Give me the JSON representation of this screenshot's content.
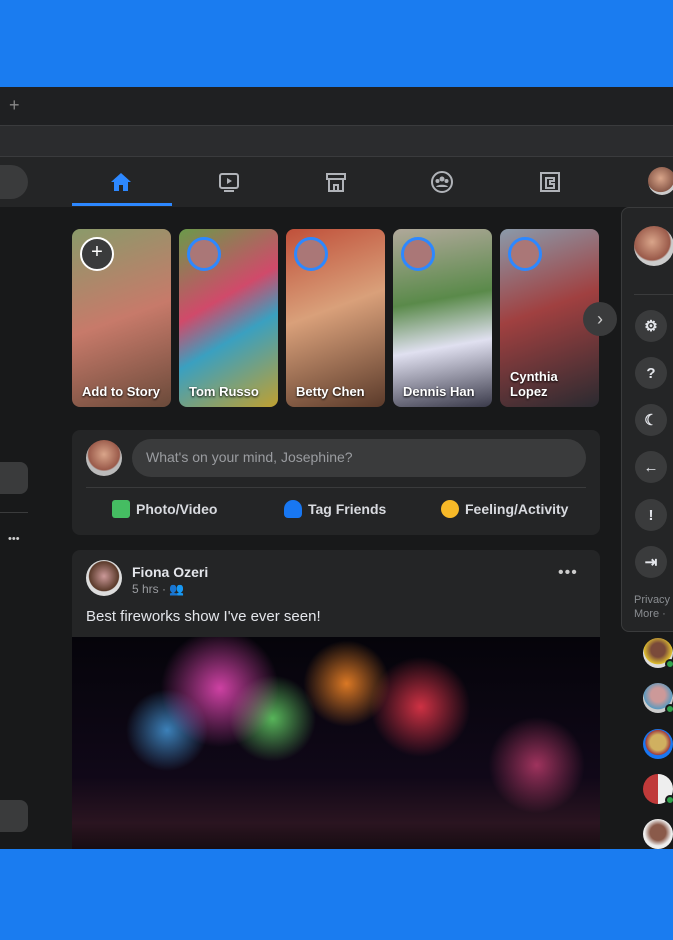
{
  "browser": {
    "new_tab": "+"
  },
  "nav": {
    "tabs": [
      {
        "name": "home",
        "active": true
      },
      {
        "name": "watch"
      },
      {
        "name": "marketplace"
      },
      {
        "name": "groups"
      },
      {
        "name": "gaming"
      }
    ],
    "accent": "#2d88ff"
  },
  "stories": [
    {
      "label": "Add to Story",
      "add": "+"
    },
    {
      "label": "Tom Russo"
    },
    {
      "label": "Betty Chen"
    },
    {
      "label": "Dennis Han"
    },
    {
      "label": "Cynthia Lopez"
    }
  ],
  "stories_next": "›",
  "composer": {
    "placeholder": "What's on your mind, Josephine?",
    "actions": [
      {
        "label": "Photo/Video"
      },
      {
        "label": "Tag Friends"
      },
      {
        "label": "Feeling/Activity"
      }
    ]
  },
  "post": {
    "author": "Fiona Ozeri",
    "time": "5 hrs · ",
    "audience": "friends-icon",
    "text": "Best fireworks show I've ever seen!",
    "more": "•••"
  },
  "menu": {
    "items": [
      "settings",
      "help",
      "dark-mode",
      "back",
      "feedback",
      "log-out"
    ],
    "footer_line1": "Privacy ·",
    "footer_line2": "More · "
  },
  "sidebar": {
    "more": "•••"
  }
}
